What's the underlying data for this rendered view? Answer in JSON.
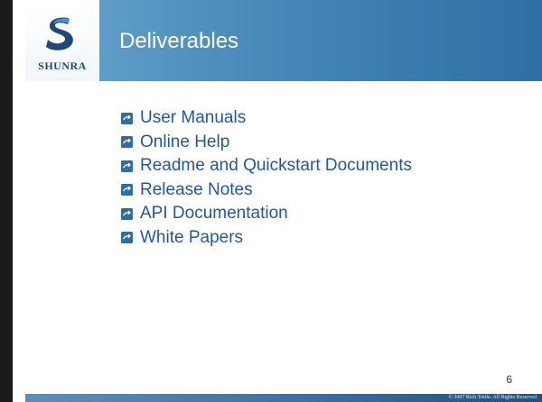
{
  "brand": {
    "logo_text": "SHUNRA",
    "logo_icon": "shunra-s-logo-icon",
    "primary_color": "#3b7caf",
    "text_color": "#2156a8"
  },
  "slide": {
    "title": "Deliverables",
    "page_number": "6",
    "copyright": "© 2007 Rich Tuttle. All Rights Reserved"
  },
  "bullets": [
    {
      "text": "User Manuals",
      "icon": "bullet-arrow-icon"
    },
    {
      "text": "Online Help",
      "icon": "bullet-arrow-icon"
    },
    {
      "text": "Readme and Quickstart Documents",
      "icon": "bullet-arrow-icon"
    },
    {
      "text": "Release Notes",
      "icon": "bullet-arrow-icon"
    },
    {
      "text": "API Documentation",
      "icon": "bullet-arrow-icon"
    },
    {
      "text": "White Papers",
      "icon": "bullet-arrow-icon"
    }
  ]
}
